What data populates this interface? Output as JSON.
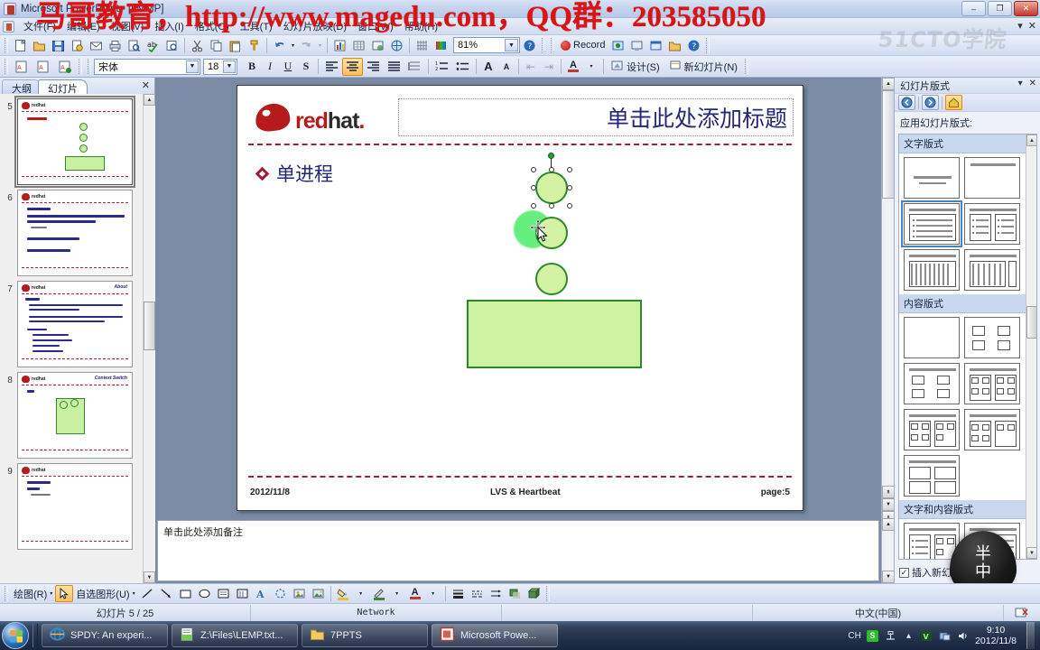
{
  "window": {
    "title": "Microsoft PowerPoint - [LMMP]",
    "minimize": "–",
    "restore": "❐",
    "close": "✕"
  },
  "overlay": {
    "banner": "马哥教育，http://www.magedu.com，QQ群：203585050",
    "watermark": "51CTO学院",
    "head_line1": "半",
    "head_line2": "中"
  },
  "menubar": {
    "items": [
      {
        "label": "文件(F)"
      },
      {
        "label": "编辑(E)"
      },
      {
        "label": "视图(V)"
      },
      {
        "label": "插入(I)"
      },
      {
        "label": "格式(O)"
      },
      {
        "label": "工具(T)"
      },
      {
        "label": "幻灯片放映(D)"
      },
      {
        "label": "窗口(W)"
      },
      {
        "label": "帮助(H)"
      }
    ],
    "doc_close": "✕",
    "doc_restore": "▾"
  },
  "toolbar_standard": {
    "buttons": [
      {
        "name": "new",
        "glyph": "🗋"
      },
      {
        "name": "open",
        "glyph": "📂"
      },
      {
        "name": "save",
        "glyph": "💾"
      },
      {
        "name": "permission",
        "glyph": "🔏"
      },
      {
        "name": "email",
        "glyph": "✉"
      },
      {
        "name": "print",
        "glyph": "🖶"
      },
      {
        "name": "print-preview",
        "glyph": "🔍"
      },
      {
        "name": "spelling",
        "glyph": "✓"
      },
      {
        "name": "research",
        "glyph": "📖"
      },
      {
        "name": "cut",
        "glyph": "✂"
      },
      {
        "name": "copy",
        "glyph": "⧉"
      },
      {
        "name": "paste",
        "glyph": "📋"
      },
      {
        "name": "format-painter",
        "glyph": "🖌"
      },
      {
        "name": "undo",
        "glyph": "↶"
      },
      {
        "name": "redo",
        "glyph": "↷"
      },
      {
        "name": "insert-chart",
        "glyph": "📊"
      },
      {
        "name": "insert-table",
        "glyph": "▦"
      },
      {
        "name": "insert-hyperlink",
        "glyph": "🔗"
      },
      {
        "name": "expand-all",
        "glyph": "🌐"
      },
      {
        "name": "show-grid",
        "glyph": "▩"
      },
      {
        "name": "color-scheme",
        "glyph": "🎨"
      }
    ],
    "zoom_value": "81%",
    "help_glyph": "?",
    "record_label": "Record",
    "record_buttons": [
      "🗔",
      "🖥",
      "🗖",
      "🗂",
      "?"
    ]
  },
  "toolbar_formatting": {
    "font_name": "宋体",
    "font_size": "18",
    "bold": "B",
    "italic": "I",
    "underline": "U",
    "shadow": "S",
    "align_left": "≡",
    "align_center": "≡",
    "align_right": "≡",
    "align_justify": "≣",
    "line_spacing": "↕",
    "numbered_list": "⒈",
    "bulleted_list": "☰",
    "increase_font": "A",
    "decrease_font": "A",
    "decrease_indent": "⇤",
    "increase_indent": "⇥",
    "font_color": "A",
    "design_label": "设计(S)",
    "new_slide_label": "新幻灯片(N)"
  },
  "left_panel": {
    "tab_outline": "大纲",
    "tab_slides": "幻灯片",
    "close": "✕",
    "thumbnails": [
      {
        "num": "5",
        "title": "",
        "selected": true,
        "kind": "circles-rect",
        "brand": "redhat"
      },
      {
        "num": "6",
        "title": "",
        "selected": false,
        "kind": "text",
        "brand": "redhat"
      },
      {
        "num": "7",
        "title": "About",
        "selected": false,
        "kind": "text",
        "brand": "redhat"
      },
      {
        "num": "8",
        "title": "Context Switch",
        "selected": false,
        "kind": "box-circles",
        "brand": "redhat"
      },
      {
        "num": "9",
        "title": "",
        "selected": false,
        "kind": "text-small",
        "brand": "redhat"
      }
    ]
  },
  "slide": {
    "brand_red": "red",
    "brand_black": "hat",
    "brand_dot": ".",
    "title_placeholder": "单击此处添加标题",
    "bullet_text": "单进程",
    "footer_date": "2012/11/8",
    "footer_center": "LVS & Heartbeat",
    "footer_page": "page:5",
    "shape_fill": "#d3f2a4",
    "shape_stroke": "#2a8a2a",
    "ghost_fill": "#3ceb5a"
  },
  "notes": {
    "placeholder": "单击此处添加备注"
  },
  "taskpane": {
    "title": "幻灯片版式",
    "collapse": "▾",
    "close": "✕",
    "nav_back": "←",
    "nav_forward": "→",
    "nav_home": "🏠",
    "apply_label": "应用幻灯片版式:",
    "groups": [
      {
        "name": "文字版式",
        "count": 6
      },
      {
        "name": "内容版式",
        "count": 7
      },
      {
        "name": "文字和内容版式",
        "count": 2
      }
    ],
    "checkbox_label": "插入新幻灯片时应用",
    "checkbox_checked": "✓"
  },
  "drawbar": {
    "draw_label": "绘图(R)",
    "select_glyph": "↖",
    "autoshapes_label": "自选图形(U)",
    "tools": [
      {
        "name": "line",
        "glyph": "╲"
      },
      {
        "name": "arrow",
        "glyph": "↘"
      },
      {
        "name": "rectangle",
        "glyph": "▭"
      },
      {
        "name": "oval",
        "glyph": "◯"
      },
      {
        "name": "text-box",
        "glyph": "▤"
      },
      {
        "name": "vertical-text-box",
        "glyph": "▥"
      },
      {
        "name": "insert-wordart",
        "glyph": "𝐀"
      },
      {
        "name": "insert-diagram",
        "glyph": "❂"
      },
      {
        "name": "insert-clip-art",
        "glyph": "🖼"
      },
      {
        "name": "insert-picture",
        "glyph": "🏞"
      },
      {
        "name": "fill-color",
        "glyph": "🪣"
      },
      {
        "name": "line-color",
        "glyph": "✎"
      },
      {
        "name": "font-color",
        "glyph": "A"
      },
      {
        "name": "line-style",
        "glyph": "≡"
      },
      {
        "name": "dash-style",
        "glyph": "┅"
      },
      {
        "name": "arrow-style",
        "glyph": "⇉"
      },
      {
        "name": "shadow-style",
        "glyph": "▩"
      },
      {
        "name": "3d-style",
        "glyph": "▨"
      }
    ]
  },
  "statusbar": {
    "slide_count": "幻灯片 5 / 25",
    "design_name": "Network",
    "language": "中文(中国)",
    "spellcheck": "📖"
  },
  "taskbar": {
    "items": [
      {
        "label": "SPDY: An experi...",
        "icon": "ie",
        "active": false
      },
      {
        "label": "Z:\\Files\\LEMP.txt...",
        "icon": "editor",
        "active": false
      },
      {
        "label": "7PPTS",
        "icon": "folder",
        "active": false
      },
      {
        "label": "Microsoft Powe...",
        "icon": "ppt",
        "active": true
      }
    ],
    "tray": {
      "ime": "CH",
      "sogou": "S",
      "network": "🖧",
      "overflow": "▴",
      "antivirus": "V",
      "share": "🗗",
      "volume": "🔊",
      "time": "9:10",
      "date": "2012/11/8"
    }
  }
}
